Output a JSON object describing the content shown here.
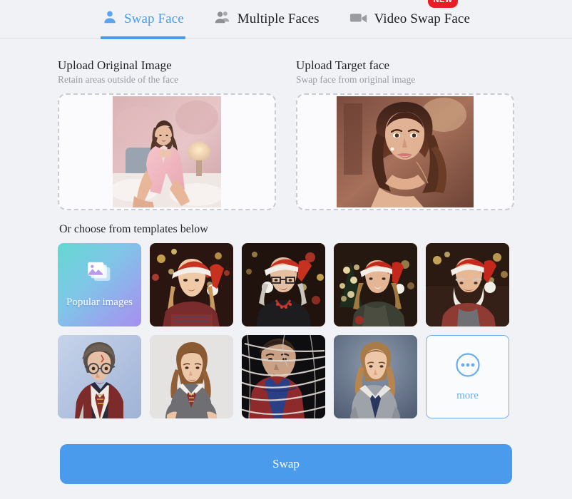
{
  "tabs": [
    {
      "label": "Swap Face",
      "icon": "person-icon",
      "active": true,
      "badge": null
    },
    {
      "label": "Multiple Faces",
      "icon": "people-icon",
      "active": false,
      "badge": null
    },
    {
      "label": "Video Swap Face",
      "icon": "video-camera-icon",
      "active": false,
      "badge": "NEW"
    }
  ],
  "uploads": [
    {
      "title": "Upload Original Image",
      "subtitle": "Retain areas outside of the face",
      "name": "original-image-dropzone",
      "has_image": true,
      "image_alt": "woman in pink robe seated on bed"
    },
    {
      "title": "Upload Target face",
      "subtitle": "Swap face from original image",
      "name": "target-face-dropzone",
      "has_image": true,
      "image_alt": "portrait of woman with long dark wavy hair"
    }
  ],
  "templates": {
    "heading": "Or choose from templates below",
    "items": [
      {
        "kind": "popular",
        "label": "Popular images",
        "icon": "images-stack-icon"
      },
      {
        "kind": "photo",
        "label": "",
        "alt": "girl in santa hat by christmas tree"
      },
      {
        "kind": "photo",
        "label": "",
        "alt": "woman with glasses and santa hat"
      },
      {
        "kind": "photo",
        "label": "",
        "alt": "young woman in santa hat"
      },
      {
        "kind": "photo",
        "label": "",
        "alt": "bearded man in santa hat"
      },
      {
        "kind": "photo",
        "label": "",
        "alt": "boy wizard with glasses and red robe"
      },
      {
        "kind": "photo",
        "label": "",
        "alt": "girl in grey school sweater and tie"
      },
      {
        "kind": "photo",
        "label": "",
        "alt": "man in red and blue suit with webs"
      },
      {
        "kind": "photo",
        "label": "",
        "alt": "school portrait of girl in grey blazer"
      },
      {
        "kind": "more",
        "label": "more",
        "icon": "more-dots-circle-icon"
      }
    ]
  },
  "action": {
    "swap_label": "Swap"
  },
  "colors": {
    "accent": "#4a9bec",
    "badge": "#ec1c24",
    "background": "#f1f2f6",
    "muted_text": "#9a9aa4"
  }
}
